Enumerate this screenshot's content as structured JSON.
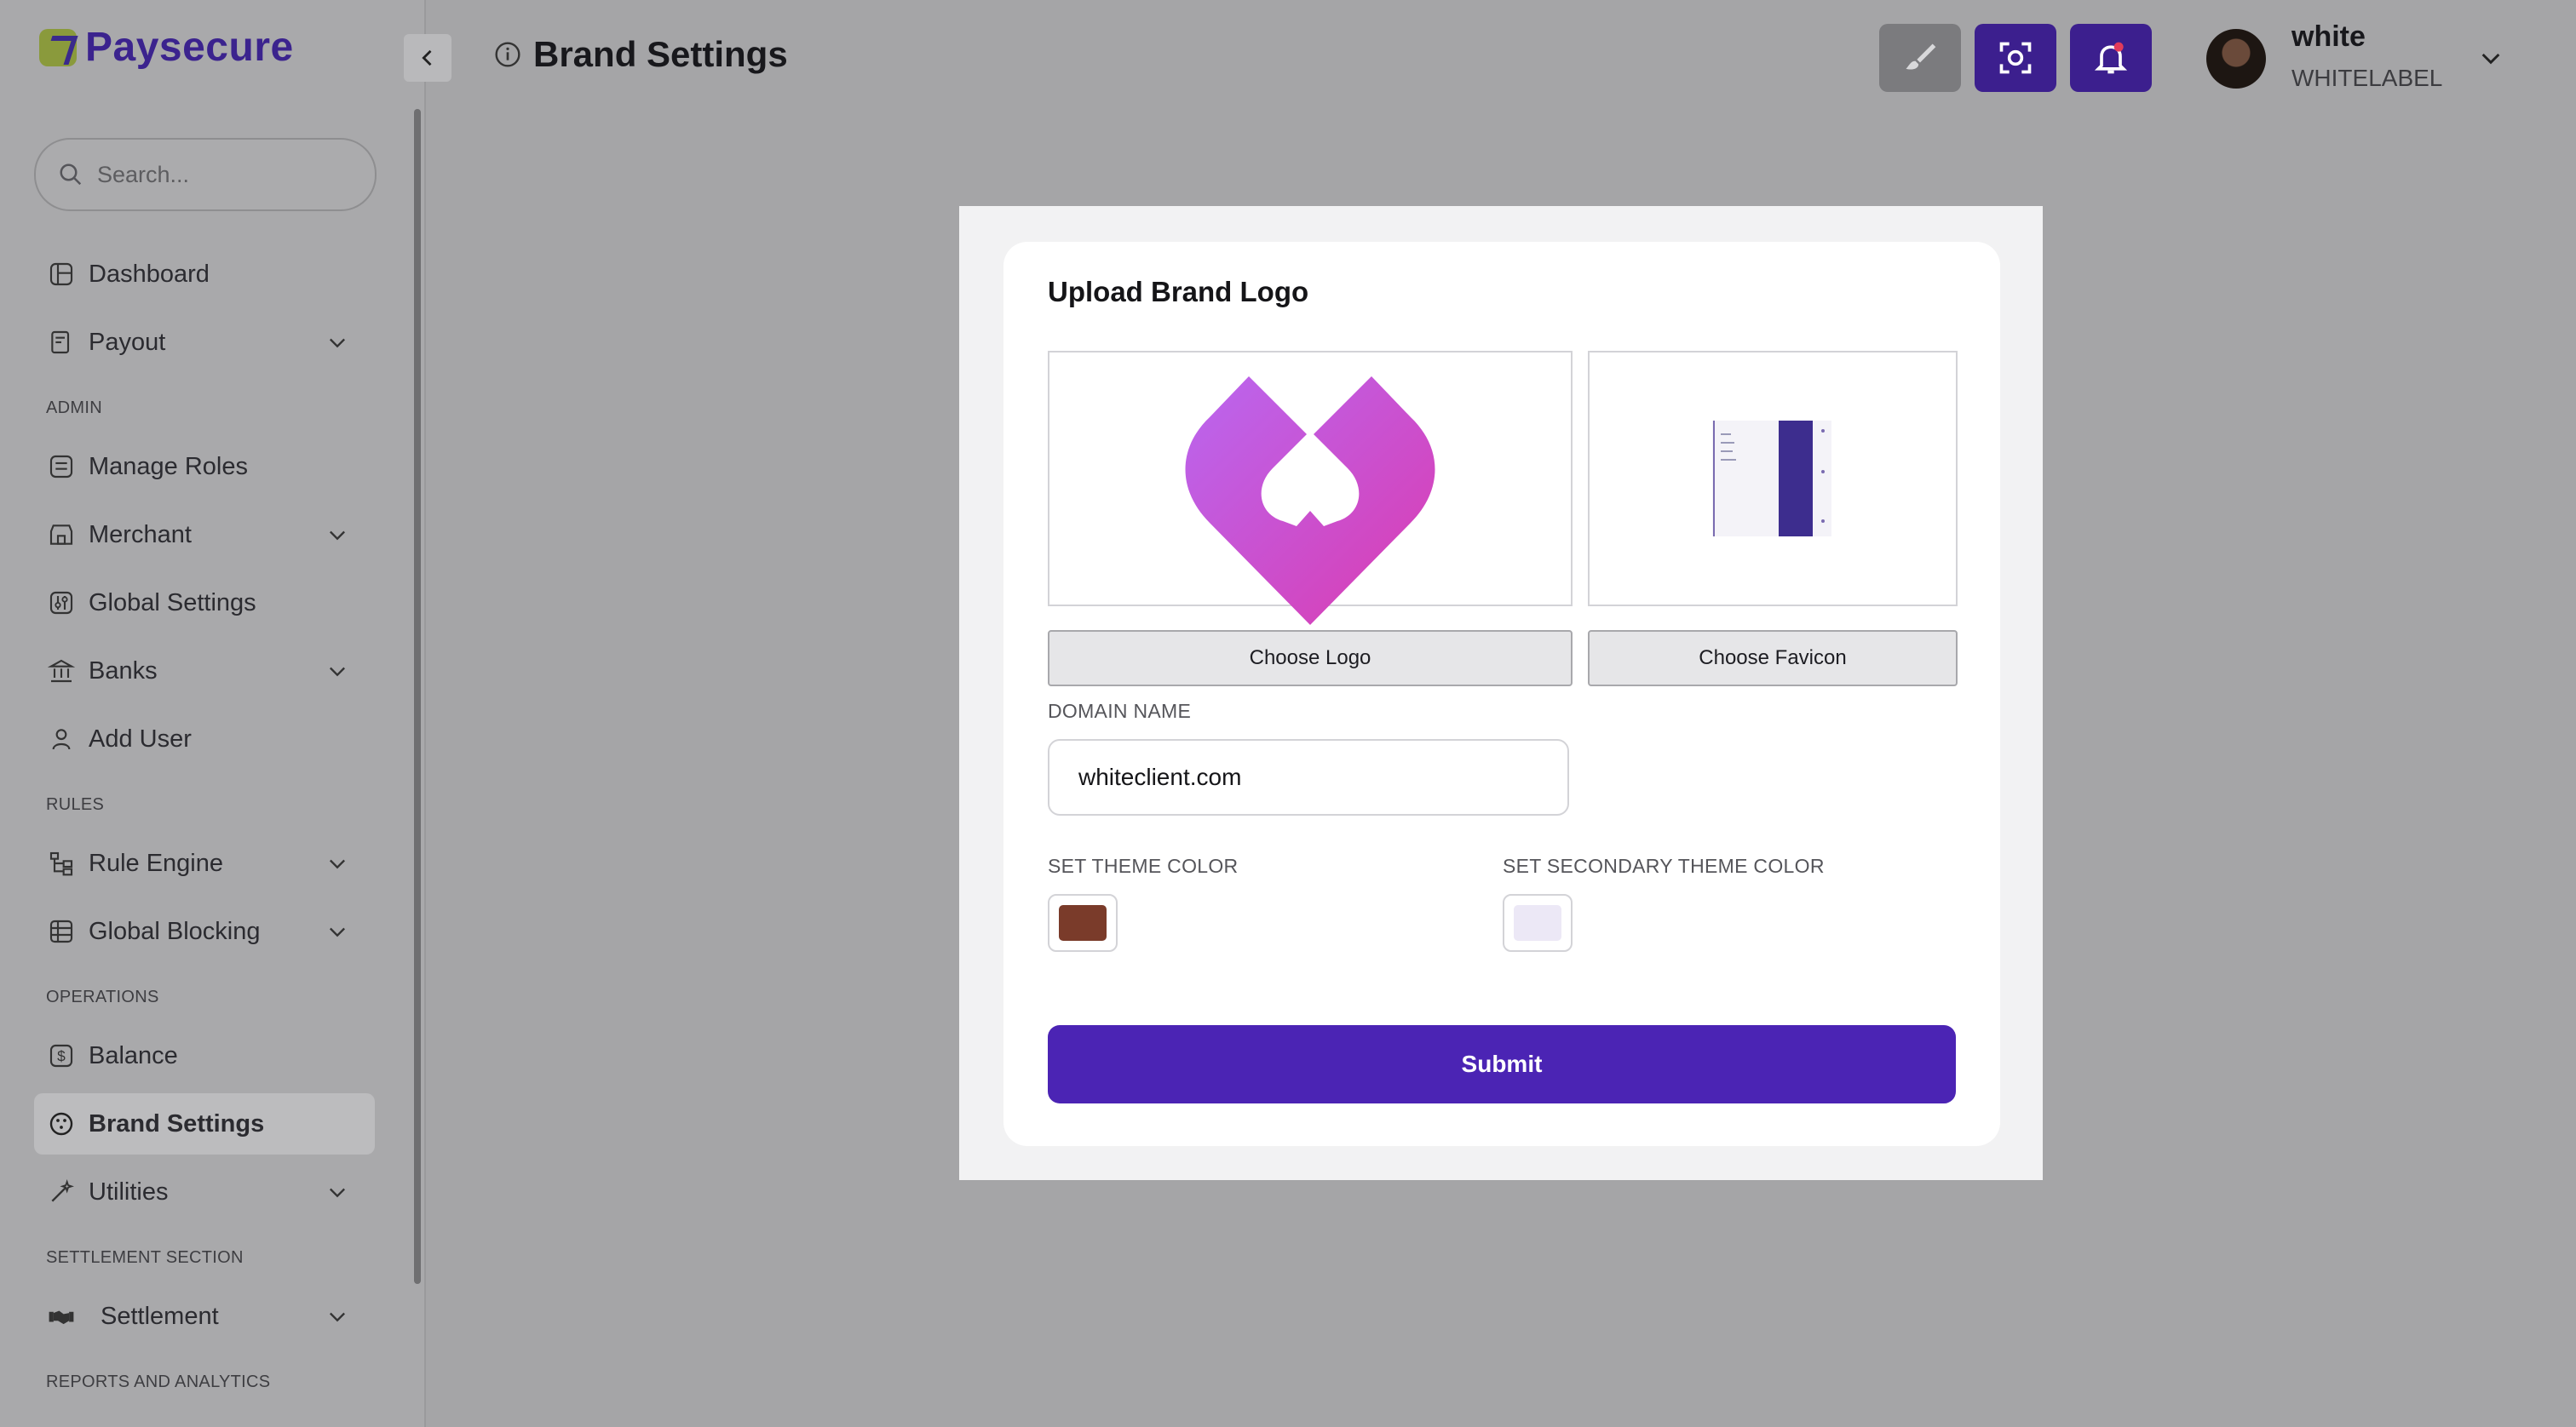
{
  "brand": {
    "name": "Paysecure"
  },
  "search": {
    "placeholder": "Search..."
  },
  "sidebar": {
    "items": [
      {
        "label": "Dashboard"
      },
      {
        "label": "Payout"
      },
      {
        "label": "Manage Roles"
      },
      {
        "label": "Merchant"
      },
      {
        "label": "Global Settings"
      },
      {
        "label": "Banks"
      },
      {
        "label": "Add User"
      },
      {
        "label": "Rule Engine"
      },
      {
        "label": "Global Blocking"
      },
      {
        "label": "Balance"
      },
      {
        "label": "Brand Settings"
      },
      {
        "label": "Utilities"
      },
      {
        "label": "Settlement"
      }
    ],
    "sections": {
      "admin": "ADMIN",
      "rules": "RULES",
      "operations": "OPERATIONS",
      "settlement": "SETTLEMENT SECTION",
      "reports": "REPORTS AND ANALYTICS"
    }
  },
  "header": {
    "title": "Brand Settings"
  },
  "user": {
    "name": "white",
    "role": "WHITELABEL"
  },
  "modal": {
    "title": "Upload Brand Logo",
    "choose_logo": "Choose Logo",
    "choose_favicon": "Choose Favicon",
    "domain_label": "DOMAIN NAME",
    "domain_value": "whiteclient.com",
    "theme_label": "SET THEME COLOR",
    "secondary_label": "SET SECONDARY THEME COLOR",
    "theme_color": "#7a3b2a",
    "secondary_color": "#ece8f6",
    "submit": "Submit"
  },
  "colors": {
    "accent": "#4b24b4",
    "sidebar_bg": "#a9a9ab",
    "overlay": "#a5a5a7"
  }
}
